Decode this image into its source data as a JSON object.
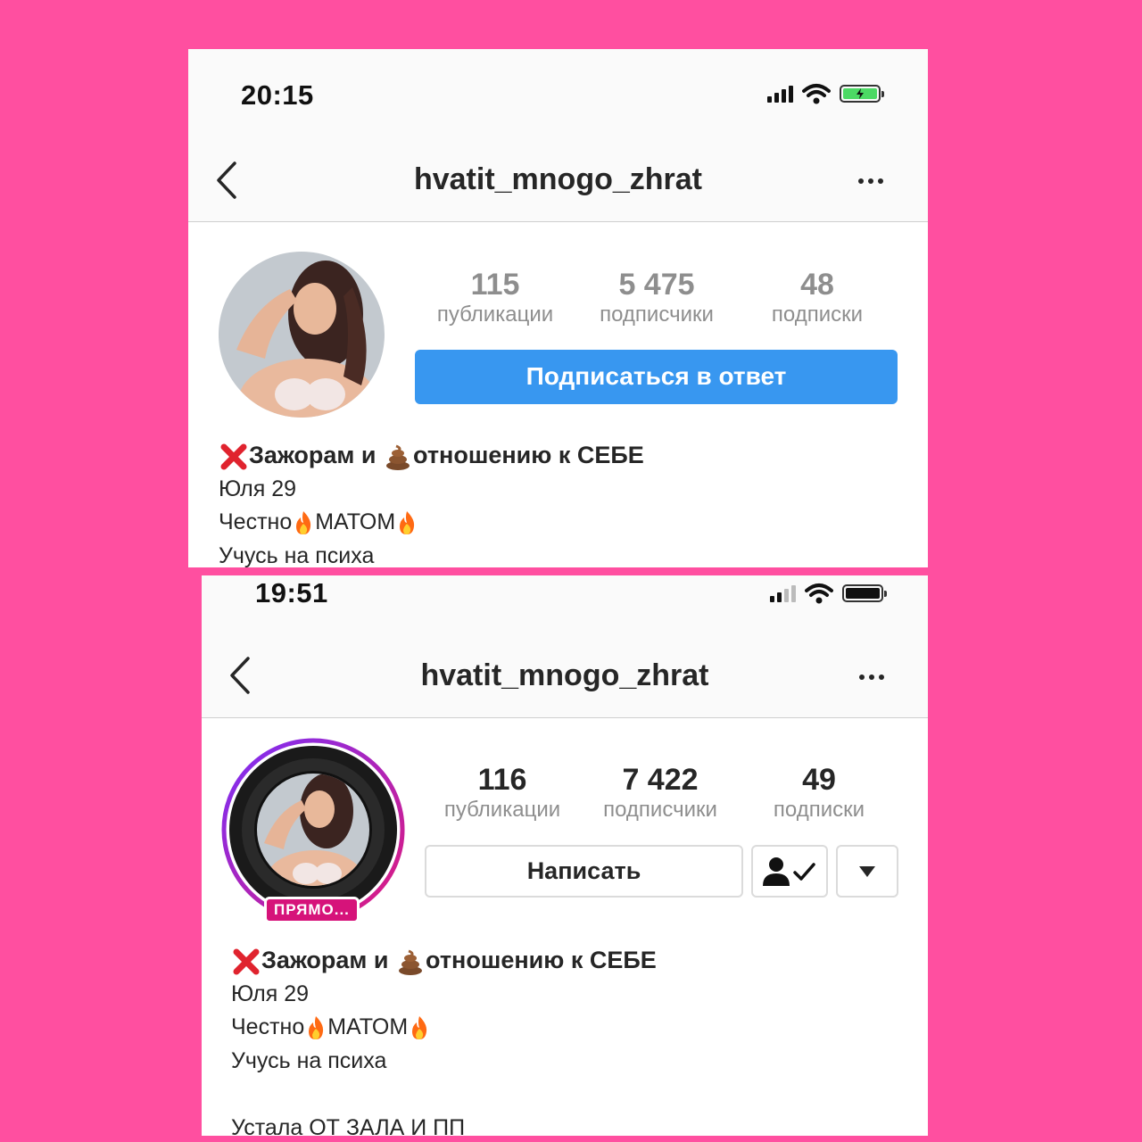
{
  "background_color": "#ff4fa0",
  "top": {
    "time": "20:15",
    "username": "hvatit_mnogo_zhrat",
    "stats": [
      {
        "value": "115",
        "label": "публикации"
      },
      {
        "value": "5 475",
        "label": "подписчики"
      },
      {
        "value": "48",
        "label": "подписки"
      }
    ],
    "follow_button": "Подписаться в ответ",
    "battery_color": "#4cd964",
    "bio": {
      "headline_part1": "Зажорам и",
      "headline_part2": "отношению к СЕБЕ",
      "line2": "Юля 29",
      "line3_a": "Честно",
      "line3_b": "МАТОМ",
      "line4": "Учусь на психа"
    }
  },
  "bottom": {
    "time": "19:51",
    "username": "hvatit_mnogo_zhrat",
    "stats": [
      {
        "value": "116",
        "label": "публикации"
      },
      {
        "value": "7 422",
        "label": "подписчики"
      },
      {
        "value": "49",
        "label": "подписки"
      }
    ],
    "message_button": "Написать",
    "live_badge": "ПРЯМО...",
    "bio": {
      "headline_part1": "Зажорам и",
      "headline_part2": "отношению к СЕБЕ",
      "line2": "Юля 29",
      "line3_a": "Честно",
      "line3_b": "МАТОМ",
      "line4": "Учусь на психа",
      "line5": "Устала ОТ ЗАЛА И ПП"
    }
  },
  "icons": [
    "back-chevron-icon",
    "more-dots-icon",
    "signal-icon",
    "wifi-icon",
    "battery-icon",
    "cross-mark-icon",
    "poop-icon",
    "fire-icon",
    "person-check-icon",
    "caret-down-icon"
  ]
}
